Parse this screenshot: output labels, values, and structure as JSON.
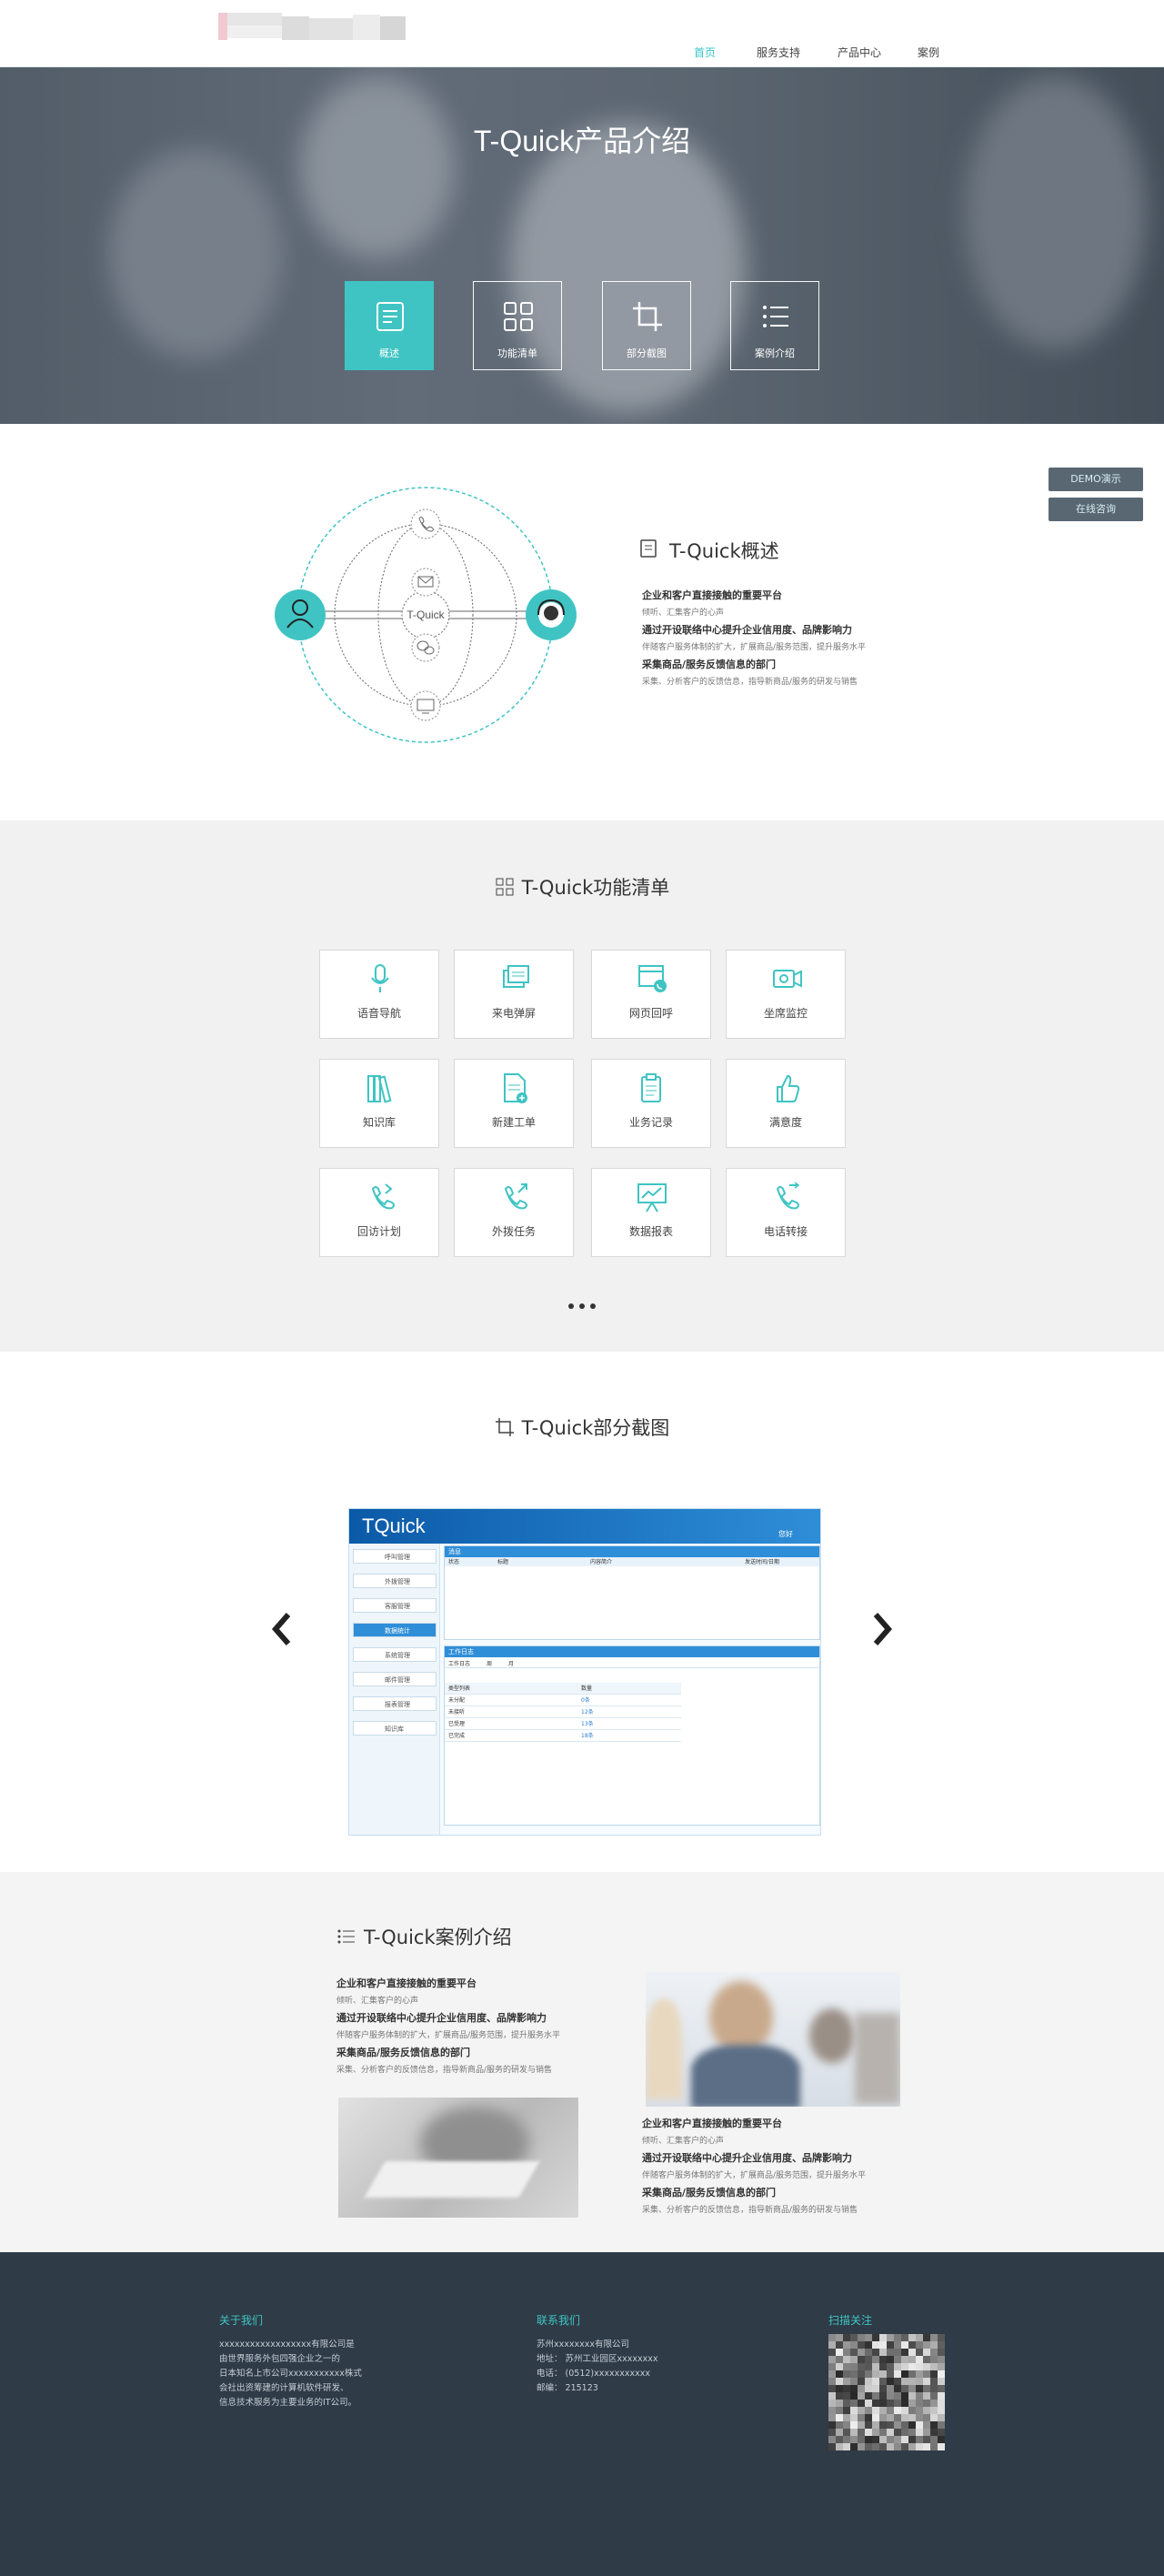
{
  "header": {
    "nav": [
      {
        "label": "首页",
        "active": true
      },
      {
        "label": "服务支持",
        "active": false
      },
      {
        "label": "产品中心",
        "active": false
      },
      {
        "label": "案例",
        "active": false
      }
    ],
    "accent_color": "#3fc4c3"
  },
  "hero": {
    "title": "T-Quick产品介绍",
    "buttons": [
      {
        "label": "概述",
        "icon": "document-icon",
        "active": true
      },
      {
        "label": "功能清单",
        "icon": "grid-icon",
        "active": false
      },
      {
        "label": "部分截图",
        "icon": "crop-icon",
        "active": false
      },
      {
        "label": "案例介绍",
        "icon": "list-icon",
        "active": false
      }
    ]
  },
  "side_buttons": {
    "demo": "DEMO演示",
    "consult": "在线咨询"
  },
  "overview": {
    "title": "T-Quick概述",
    "diagram_center": "T-Quick",
    "items": [
      {
        "heading": "企业和客户直接接触的重要平台",
        "sub": "倾听、汇集客户的心声"
      },
      {
        "heading": "通过开设联络中心提升企业信用度、品牌影响力",
        "sub": "伴随客户服务体制的扩大，扩展商品/服务范围，提升服务水平"
      },
      {
        "heading": "采集商品/服务反馈信息的部门",
        "sub": "采集、分析客户的反馈信息，指导新商品/服务的研发与销售"
      }
    ]
  },
  "features": {
    "title": "T-Quick功能清单",
    "items": [
      {
        "label": "语音导航",
        "icon": "microphone-icon"
      },
      {
        "label": "来电弹屏",
        "icon": "popup-window-icon"
      },
      {
        "label": "网页回呼",
        "icon": "web-callback-icon"
      },
      {
        "label": "坐席监控",
        "icon": "monitor-camera-icon"
      },
      {
        "label": "知识库",
        "icon": "books-icon"
      },
      {
        "label": "新建工单",
        "icon": "new-document-icon"
      },
      {
        "label": "业务记录",
        "icon": "clipboard-icon"
      },
      {
        "label": "满意度",
        "icon": "thumbs-up-icon"
      },
      {
        "label": "回访计划",
        "icon": "phone-return-icon"
      },
      {
        "label": "外拨任务",
        "icon": "phone-outgoing-icon"
      },
      {
        "label": "数据报表",
        "icon": "chart-board-icon"
      },
      {
        "label": "电话转接",
        "icon": "phone-transfer-icon"
      }
    ],
    "more": "..."
  },
  "screenshots": {
    "title": "T-Quick部分截图",
    "app": {
      "logo": "TQuick",
      "user": "您好",
      "menu": [
        "呼叫管理",
        "外拨管理",
        "客服管理",
        "数据统计",
        "系统管理",
        "邮件管理",
        "报表管理",
        "知识库"
      ],
      "panel1_title": "消息",
      "panel1_cols": [
        "状态",
        "标题",
        "内容简介",
        "发送时间/日期"
      ],
      "panel2_title": "工作日志",
      "panel2_tabs": [
        "工作日志",
        "周",
        "月"
      ],
      "table_cols": [
        "类型列表",
        "数量"
      ],
      "table_rows": [
        [
          "未分配",
          "0条"
        ],
        [
          "未接听",
          "12条"
        ],
        [
          "已受理",
          "13条"
        ],
        [
          "已完成",
          "18条"
        ]
      ]
    }
  },
  "cases": {
    "title": "T-Quick案例介绍",
    "left": [
      {
        "heading": "企业和客户直接接触的重要平台",
        "sub": "倾听、汇集客户的心声"
      },
      {
        "heading": "通过开设联络中心提升企业信用度、品牌影响力",
        "sub": "伴随客户服务体制的扩大，扩展商品/服务范围，提升服务水平"
      },
      {
        "heading": "采集商品/服务反馈信息的部门",
        "sub": "采集、分析客户的反馈信息，指导新商品/服务的研发与销售"
      }
    ],
    "right": [
      {
        "heading": "企业和客户直接接触的重要平台",
        "sub": "倾听、汇集客户的心声"
      },
      {
        "heading": "通过开设联络中心提升企业信用度、品牌影响力",
        "sub": "伴随客户服务体制的扩大，扩展商品/服务范围，提升服务水平"
      },
      {
        "heading": "采集商品/服务反馈信息的部门",
        "sub": "采集、分析客户的反馈信息，指导新商品/服务的研发与销售"
      }
    ]
  },
  "footer": {
    "about_title": "关于我们",
    "about_lines": [
      "xxxxxxxxxxxxxxxxxx有限公司是",
      "由世界服务外包四强企业之一的",
      "日本知名上市公司xxxxxxxxxxx株式",
      "会社出资筹建的计算机软件研发、",
      "信息技术服务为主要业务的IT公司。"
    ],
    "contact_title": "联系我们",
    "contact_lines": [
      "苏州xxxxxxxx有限公司",
      "地址：  苏州工业园区xxxxxxxx",
      "电话：  (0512)xxxxxxxxxxx",
      "邮编：  215123"
    ],
    "qr_title": "扫描关注"
  }
}
